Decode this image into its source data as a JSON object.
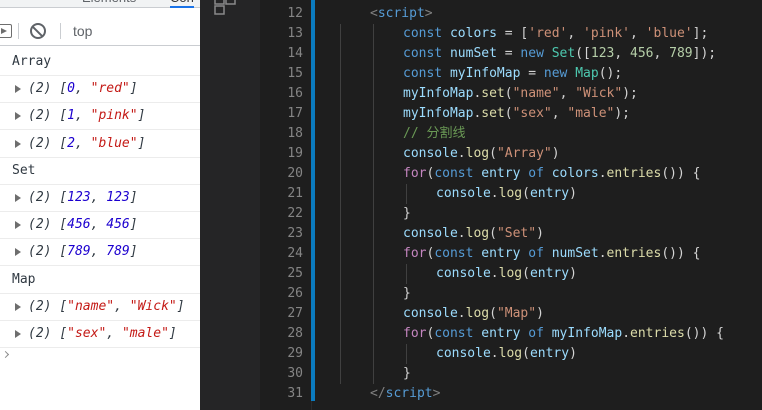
{
  "devtools": {
    "tabs": [
      "Elements",
      "Con"
    ],
    "context": "top",
    "console": [
      {
        "kind": "log",
        "text": "Array"
      },
      {
        "kind": "obj",
        "len": "(2)",
        "items": [
          {
            "t": "num",
            "v": "0"
          },
          {
            "t": "str",
            "v": "\"red\""
          }
        ]
      },
      {
        "kind": "obj",
        "len": "(2)",
        "items": [
          {
            "t": "num",
            "v": "1"
          },
          {
            "t": "str",
            "v": "\"pink\""
          }
        ]
      },
      {
        "kind": "obj",
        "len": "(2)",
        "items": [
          {
            "t": "num",
            "v": "2"
          },
          {
            "t": "str",
            "v": "\"blue\""
          }
        ]
      },
      {
        "kind": "log",
        "text": "Set"
      },
      {
        "kind": "obj",
        "len": "(2)",
        "items": [
          {
            "t": "num",
            "v": "123"
          },
          {
            "t": "num",
            "v": "123"
          }
        ]
      },
      {
        "kind": "obj",
        "len": "(2)",
        "items": [
          {
            "t": "num",
            "v": "456"
          },
          {
            "t": "num",
            "v": "456"
          }
        ]
      },
      {
        "kind": "obj",
        "len": "(2)",
        "items": [
          {
            "t": "num",
            "v": "789"
          },
          {
            "t": "num",
            "v": "789"
          }
        ]
      },
      {
        "kind": "log",
        "text": "Map"
      },
      {
        "kind": "obj",
        "len": "(2)",
        "items": [
          {
            "t": "str",
            "v": "\"name\""
          },
          {
            "t": "str",
            "v": "\"Wick\""
          }
        ]
      },
      {
        "kind": "obj",
        "len": "(2)",
        "items": [
          {
            "t": "str",
            "v": "\"sex\""
          },
          {
            "t": "str",
            "v": "\"male\""
          }
        ]
      }
    ]
  },
  "editor": {
    "lines": [
      {
        "num": "12",
        "indent": 1,
        "tokens": [
          [
            "tag",
            "<"
          ],
          [
            "tagname",
            "script"
          ],
          [
            "tag",
            ">"
          ]
        ]
      },
      {
        "num": "13",
        "indent": 2,
        "tokens": [
          [
            "kw",
            "const"
          ],
          [
            "punc",
            " "
          ],
          [
            "var",
            "colors"
          ],
          [
            "punc",
            " = ["
          ],
          [
            "str",
            "'red'"
          ],
          [
            "punc",
            ", "
          ],
          [
            "str",
            "'pink'"
          ],
          [
            "punc",
            ", "
          ],
          [
            "str",
            "'blue'"
          ],
          [
            "punc",
            "];"
          ]
        ]
      },
      {
        "num": "14",
        "indent": 2,
        "tokens": [
          [
            "kw",
            "const"
          ],
          [
            "punc",
            " "
          ],
          [
            "var",
            "numSet"
          ],
          [
            "punc",
            " = "
          ],
          [
            "kw",
            "new"
          ],
          [
            "punc",
            " "
          ],
          [
            "cls",
            "Set"
          ],
          [
            "punc",
            "(["
          ],
          [
            "num",
            "123"
          ],
          [
            "punc",
            ", "
          ],
          [
            "num",
            "456"
          ],
          [
            "punc",
            ", "
          ],
          [
            "num",
            "789"
          ],
          [
            "punc",
            "]);"
          ]
        ]
      },
      {
        "num": "15",
        "indent": 2,
        "tokens": [
          [
            "kw",
            "const"
          ],
          [
            "punc",
            " "
          ],
          [
            "var",
            "myInfoMap"
          ],
          [
            "punc",
            " = "
          ],
          [
            "kw",
            "new"
          ],
          [
            "punc",
            " "
          ],
          [
            "cls",
            "Map"
          ],
          [
            "punc",
            "();"
          ]
        ]
      },
      {
        "num": "16",
        "indent": 2,
        "tokens": [
          [
            "var",
            "myInfoMap"
          ],
          [
            "punc",
            "."
          ],
          [
            "func",
            "set"
          ],
          [
            "punc",
            "("
          ],
          [
            "str",
            "\"name\""
          ],
          [
            "punc",
            ", "
          ],
          [
            "str",
            "\"Wick\""
          ],
          [
            "punc",
            ");"
          ]
        ]
      },
      {
        "num": "17",
        "indent": 2,
        "tokens": [
          [
            "var",
            "myInfoMap"
          ],
          [
            "punc",
            "."
          ],
          [
            "func",
            "set"
          ],
          [
            "punc",
            "("
          ],
          [
            "str",
            "\"sex\""
          ],
          [
            "punc",
            ", "
          ],
          [
            "str",
            "\"male\""
          ],
          [
            "punc",
            ");"
          ]
        ]
      },
      {
        "num": "18",
        "indent": 2,
        "tokens": [
          [
            "com",
            "// 分割线"
          ]
        ]
      },
      {
        "num": "19",
        "indent": 2,
        "tokens": [
          [
            "var",
            "console"
          ],
          [
            "punc",
            "."
          ],
          [
            "func",
            "log"
          ],
          [
            "punc",
            "("
          ],
          [
            "str",
            "\"Array\""
          ],
          [
            "punc",
            ")"
          ]
        ]
      },
      {
        "num": "20",
        "indent": 2,
        "tokens": [
          [
            "ctrl",
            "for"
          ],
          [
            "punc",
            "("
          ],
          [
            "kw",
            "const"
          ],
          [
            "punc",
            " "
          ],
          [
            "var",
            "entry"
          ],
          [
            "punc",
            " "
          ],
          [
            "kw",
            "of"
          ],
          [
            "punc",
            " "
          ],
          [
            "var",
            "colors"
          ],
          [
            "punc",
            "."
          ],
          [
            "func",
            "entries"
          ],
          [
            "punc",
            "()) {"
          ]
        ]
      },
      {
        "num": "21",
        "indent": 3,
        "tokens": [
          [
            "var",
            "console"
          ],
          [
            "punc",
            "."
          ],
          [
            "func",
            "log"
          ],
          [
            "punc",
            "("
          ],
          [
            "var",
            "entry"
          ],
          [
            "punc",
            ")"
          ]
        ]
      },
      {
        "num": "22",
        "indent": 2,
        "tokens": [
          [
            "punc",
            "}"
          ]
        ]
      },
      {
        "num": "23",
        "indent": 2,
        "tokens": [
          [
            "var",
            "console"
          ],
          [
            "punc",
            "."
          ],
          [
            "func",
            "log"
          ],
          [
            "punc",
            "("
          ],
          [
            "str",
            "\"Set\""
          ],
          [
            "punc",
            ")"
          ]
        ]
      },
      {
        "num": "24",
        "indent": 2,
        "tokens": [
          [
            "ctrl",
            "for"
          ],
          [
            "punc",
            "("
          ],
          [
            "kw",
            "const"
          ],
          [
            "punc",
            " "
          ],
          [
            "var",
            "entry"
          ],
          [
            "punc",
            " "
          ],
          [
            "kw",
            "of"
          ],
          [
            "punc",
            " "
          ],
          [
            "var",
            "numSet"
          ],
          [
            "punc",
            "."
          ],
          [
            "func",
            "entries"
          ],
          [
            "punc",
            "()) {"
          ]
        ]
      },
      {
        "num": "25",
        "indent": 3,
        "tokens": [
          [
            "var",
            "console"
          ],
          [
            "punc",
            "."
          ],
          [
            "func",
            "log"
          ],
          [
            "punc",
            "("
          ],
          [
            "var",
            "entry"
          ],
          [
            "punc",
            ")"
          ]
        ]
      },
      {
        "num": "26",
        "indent": 2,
        "tokens": [
          [
            "punc",
            "}"
          ]
        ]
      },
      {
        "num": "27",
        "indent": 2,
        "tokens": [
          [
            "var",
            "console"
          ],
          [
            "punc",
            "."
          ],
          [
            "func",
            "log"
          ],
          [
            "punc",
            "("
          ],
          [
            "str",
            "\"Map\""
          ],
          [
            "punc",
            ")"
          ]
        ]
      },
      {
        "num": "28",
        "indent": 2,
        "tokens": [
          [
            "ctrl",
            "for"
          ],
          [
            "punc",
            "("
          ],
          [
            "kw",
            "const"
          ],
          [
            "punc",
            " "
          ],
          [
            "var",
            "entry"
          ],
          [
            "punc",
            " "
          ],
          [
            "kw",
            "of"
          ],
          [
            "punc",
            " "
          ],
          [
            "var",
            "myInfoMap"
          ],
          [
            "punc",
            "."
          ],
          [
            "func",
            "entries"
          ],
          [
            "punc",
            "()) {"
          ]
        ]
      },
      {
        "num": "29",
        "indent": 3,
        "tokens": [
          [
            "var",
            "console"
          ],
          [
            "punc",
            "."
          ],
          [
            "func",
            "log"
          ],
          [
            "punc",
            "("
          ],
          [
            "var",
            "entry"
          ],
          [
            "punc",
            ")"
          ]
        ]
      },
      {
        "num": "30",
        "indent": 2,
        "tokens": [
          [
            "punc",
            "}"
          ]
        ]
      },
      {
        "num": "31",
        "indent": 1,
        "tokens": [
          [
            "tag",
            "</"
          ],
          [
            "tagname",
            "script"
          ],
          [
            "tag",
            ">"
          ]
        ]
      }
    ]
  }
}
